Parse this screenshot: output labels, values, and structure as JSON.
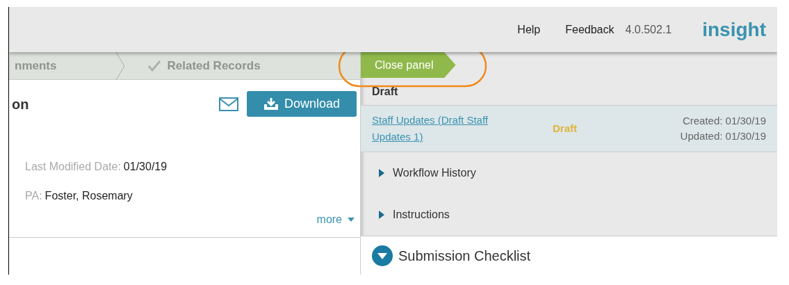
{
  "header": {
    "links": [
      "Help",
      "Feedback"
    ],
    "version": "4.0.502.1",
    "logo": "insight"
  },
  "steps": [
    {
      "label": "nments",
      "checked": false
    },
    {
      "label": "Related Records",
      "checked": true
    }
  ],
  "record": {
    "title": "on",
    "download": "Download",
    "fields": [
      {
        "label": "Last Modified Date:",
        "value": "01/30/19"
      },
      {
        "label": "PA:",
        "value": "Foster, Rosemary"
      }
    ],
    "more": "more"
  },
  "panel": {
    "close": "Close panel",
    "heading": "Draft",
    "item": {
      "link": "Staff Updates (Draft Staff Updates 1)",
      "status": "Draft",
      "created": "Created: 01/30/19",
      "updated": "Updated: 01/30/19"
    },
    "sections": [
      {
        "label": "Workflow History",
        "expanded": false
      },
      {
        "label": "Instructions",
        "expanded": false
      },
      {
        "label": "Submission Checklist",
        "expanded": true
      }
    ]
  }
}
